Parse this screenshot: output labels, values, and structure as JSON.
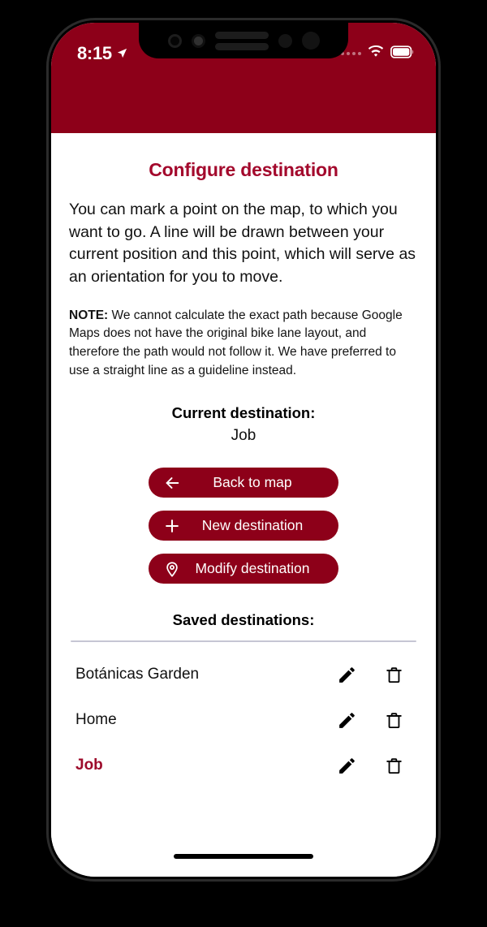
{
  "status_bar": {
    "time": "8:15",
    "location_icon": "location-arrow-icon",
    "signal_icon": "cellular-signal-dots-icon",
    "wifi_icon": "wifi-icon",
    "battery_icon": "battery-full-icon"
  },
  "colors": {
    "header_red": "#8d0019",
    "title_red": "#a3082c",
    "button_red": "#8d0019",
    "active_item_red": "#9d0b2b",
    "divider": "#c6c6d4",
    "text": "#111111"
  },
  "screen": {
    "title": "Configure destination",
    "intro": "You can mark a point on the map, to which you want to go. A line will be drawn between your current position and this point, which will serve as an orientation for you to move.",
    "note_label": "NOTE:",
    "note_text": " We cannot calculate the exact path because Google Maps does not have the original bike lane layout, and therefore the path would not follow it. We have preferred to use a straight line as a guideline instead.",
    "current_destination_heading": "Current destination:",
    "current_destination_value": "Job",
    "saved_heading": "Saved destinations:"
  },
  "buttons": [
    {
      "label": "Back to map",
      "icon": "arrow-left-icon"
    },
    {
      "label": "New destination",
      "icon": "plus-icon"
    },
    {
      "label": "Modify destination",
      "icon": "map-pin-icon"
    }
  ],
  "saved_destinations": [
    {
      "name": "Botánicas Garden",
      "active": false,
      "edit_icon": "pencil-icon",
      "delete_icon": "trash-icon"
    },
    {
      "name": "Home",
      "active": false,
      "edit_icon": "pencil-icon",
      "delete_icon": "trash-icon"
    },
    {
      "name": "Job",
      "active": true,
      "edit_icon": "pencil-icon",
      "delete_icon": "trash-icon"
    }
  ]
}
